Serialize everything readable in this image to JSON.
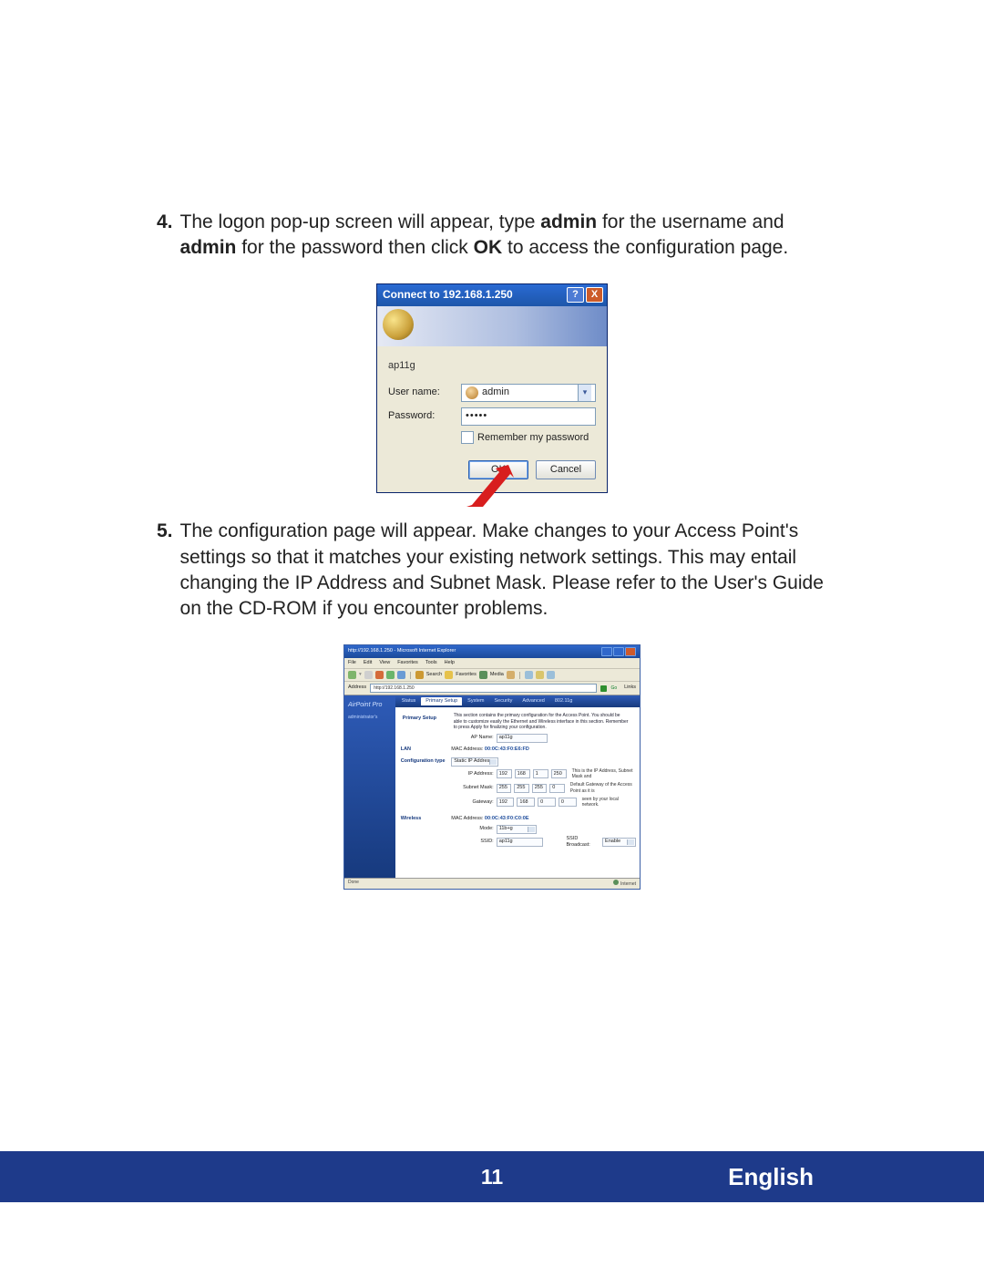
{
  "steps": {
    "s4": {
      "num": "4.",
      "text_before_admin1": "The logon pop-up screen will appear, type ",
      "admin1": "admin",
      "text_mid1": " for the username and ",
      "admin2": "admin",
      "text_mid2": " for the password then click ",
      "ok": "OK",
      "text_after": " to access the configuration page."
    },
    "s5": {
      "num": "5.",
      "text": "The configuration page will appear. Make changes to your Access Point's settings so that it matches your existing network settings. This may entail changing the IP Address and Subnet Mask. Please refer to the User's Guide on the CD-ROM if you encounter problems."
    }
  },
  "dialog": {
    "title": "Connect to 192.168.1.250",
    "help_icon": "?",
    "close_icon": "X",
    "realm": "ap11g",
    "user_label": "User name:",
    "user_value": "admin",
    "pass_label": "Password:",
    "pass_value": "•••••",
    "remember_label": "Remember my password",
    "ok": "OK",
    "cancel": "Cancel"
  },
  "ie": {
    "title": "http://192.168.1.250 - Microsoft Internet Explorer",
    "menu": [
      "File",
      "Edit",
      "View",
      "Favorites",
      "Tools",
      "Help"
    ],
    "toolbar_text": {
      "search": "Search",
      "favorites": "Favorites",
      "media": "Media"
    },
    "addr_label": "Address",
    "addr_value": "http://192.168.1.250",
    "go": "Go",
    "links": "Links",
    "side": {
      "logo": "AirPoint Pro",
      "sel": "administrator's",
      "items": [
        "Primary Setup",
        "LAN",
        "Configuration type",
        "Wireless"
      ]
    },
    "tabs": [
      "Status",
      "Primary Setup",
      "System",
      "Security",
      "Advanced",
      "802.11g"
    ],
    "desc": "This section contains the primary configuration for the Access Point. You should be able to customize easily the Ethernet and Wireless interface in this section. Remember to press Apply for finalizing your configuration.",
    "desc_label": "Primary Setup",
    "ap_name_label": "AP Name:",
    "ap_name_value": "ap11g",
    "lan_mac_label": "MAC Address:",
    "lan_mac_value": "00:0C:43:F0:E6:FD",
    "cfg_type_label": "Configuration type:",
    "cfg_type_value": "Static IP Address",
    "ip_label": "IP Address:",
    "ip": [
      "192",
      "168",
      "1",
      "250"
    ],
    "ip_note": "This is the IP Address, Subnet Mask and",
    "mask_label": "Subnet Mask:",
    "mask": [
      "255",
      "255",
      "255",
      "0"
    ],
    "mask_note": "Default Gateway of the Access Point as it is",
    "gw_label": "Gateway:",
    "gw": [
      "192",
      "168",
      "0",
      "0"
    ],
    "gw_note": "seen by your local network.",
    "w_mac_label": "MAC Address:",
    "w_mac_value": "00:0C:43:F0:C0:0E",
    "mode_label": "Mode:",
    "mode_value": "11b+g",
    "ssid_label": "SSID:",
    "ssid_value": "ap11g",
    "bcast_label": "SSID Broadcast:",
    "bcast_value": "Enable",
    "status_left": "Done",
    "status_right": "Internet"
  },
  "footer": {
    "page": "11",
    "lang": "English"
  }
}
